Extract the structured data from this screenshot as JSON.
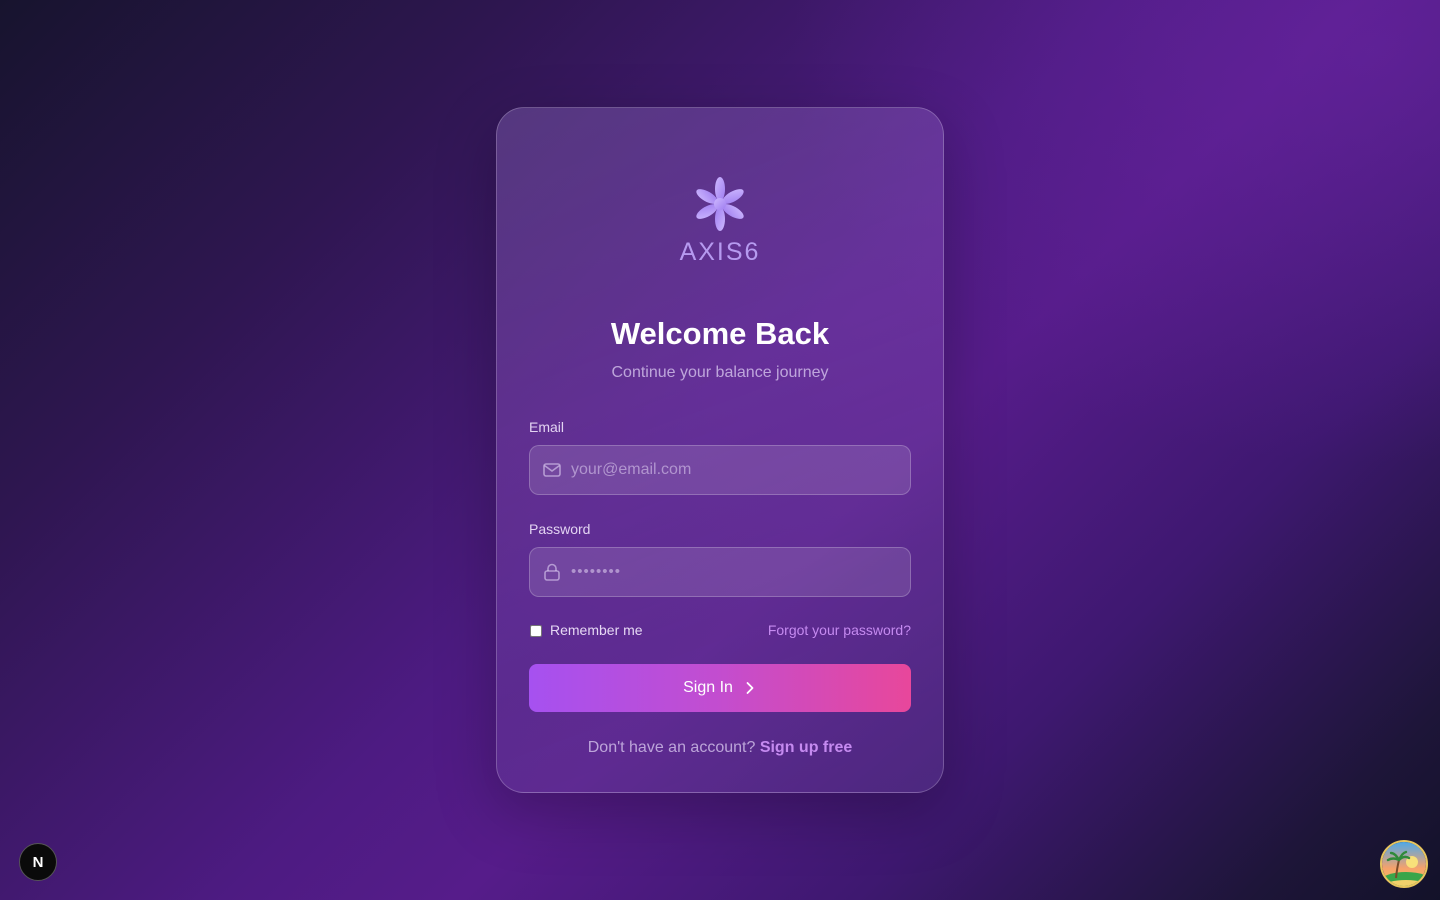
{
  "brand": {
    "name": "AXIS6"
  },
  "heading": {
    "title": "Welcome Back",
    "subtitle": "Continue your balance journey"
  },
  "form": {
    "email": {
      "label": "Email",
      "placeholder": "your@email.com",
      "icon": "mail-icon"
    },
    "password": {
      "label": "Password",
      "masked_value": "••••••••",
      "icon": "lock-icon"
    },
    "remember_label": "Remember me",
    "remember_checked": false,
    "forgot_label": "Forgot your password?",
    "submit_label": "Sign In",
    "submit_icon": "chevron-right-icon"
  },
  "footer": {
    "question": "Don't have an account?",
    "signup_label": "Sign up free"
  },
  "dev_badge": {
    "letter": "N"
  },
  "colors": {
    "accent": "#c58af0",
    "button_start": "#a651f0",
    "button_end": "#e8479b",
    "logo": "#b69af0"
  }
}
